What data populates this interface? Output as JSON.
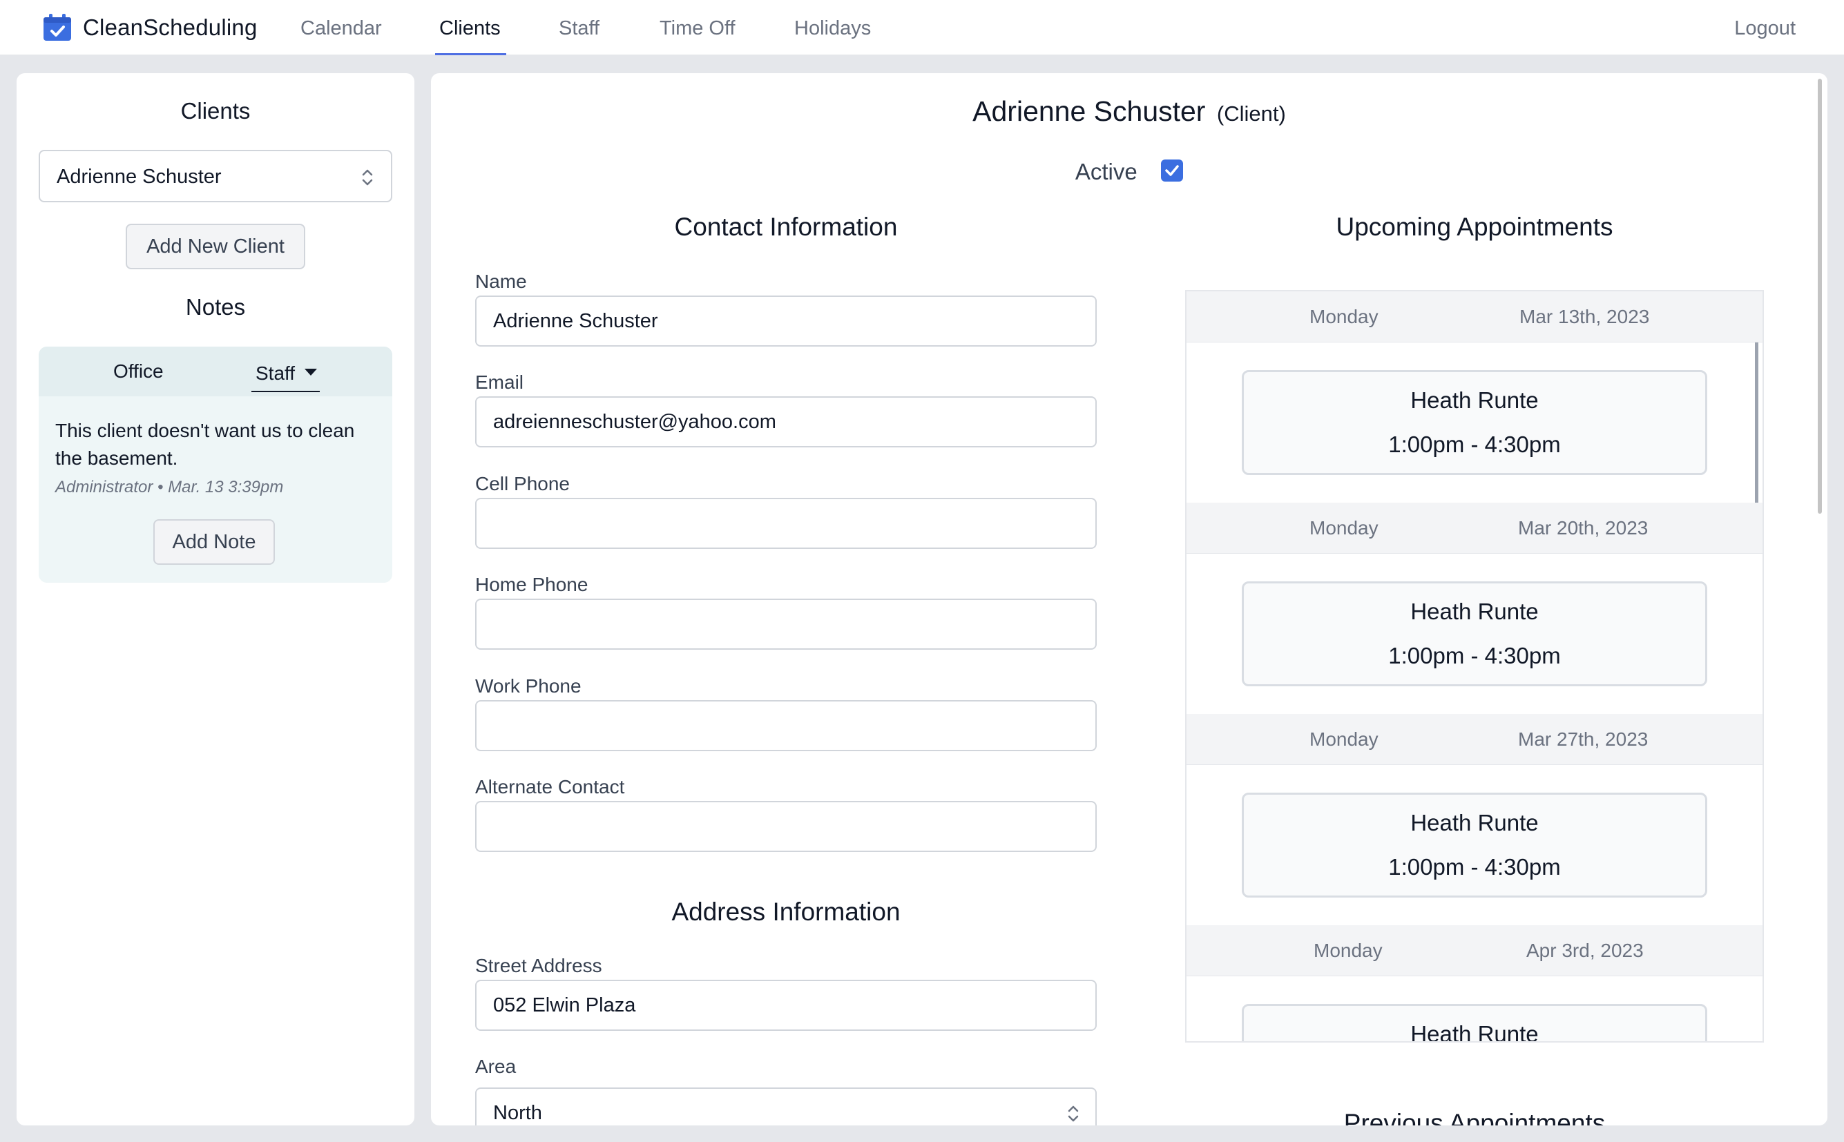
{
  "app": {
    "name": "CleanScheduling"
  },
  "nav": {
    "items": [
      {
        "label": "Calendar"
      },
      {
        "label": "Clients"
      },
      {
        "label": "Staff"
      },
      {
        "label": "Time Off"
      },
      {
        "label": "Holidays"
      }
    ],
    "active": "Clients",
    "logout_label": "Logout"
  },
  "sidebar": {
    "title": "Clients",
    "selected_client": "Adrienne Schuster",
    "add_client_label": "Add New Client",
    "notes_title": "Notes",
    "notes_tabs": [
      {
        "label": "Office"
      },
      {
        "label": "Staff"
      }
    ],
    "notes_active_tab": "Staff",
    "notes": [
      {
        "text": "This client doesn't want us to clean the basement.",
        "author": "Administrator",
        "timestamp": "Mar. 13 3:39pm"
      }
    ],
    "note_meta_separator": "•",
    "add_note_label": "Add Note"
  },
  "client": {
    "name": "Adrienne Schuster",
    "role_tag": "(Client)",
    "active_label": "Active",
    "active": true
  },
  "contact": {
    "title": "Contact Information",
    "name_label": "Name",
    "name_value": "Adrienne Schuster",
    "email_label": "Email",
    "email_value": "adreienneschuster@yahoo.com",
    "cell_label": "Cell Phone",
    "cell_value": "",
    "home_label": "Home Phone",
    "home_value": "",
    "work_label": "Work Phone",
    "work_value": "",
    "alt_label": "Alternate Contact",
    "alt_value": ""
  },
  "address": {
    "title": "Address Information",
    "street_label": "Street Address",
    "street_value": "052 Elwin Plaza",
    "area_label": "Area",
    "area_value": "North"
  },
  "appointments": {
    "upcoming_title": "Upcoming Appointments",
    "previous_title": "Previous Appointments",
    "upcoming": [
      {
        "weekday": "Monday",
        "date": "Mar 13th, 2023",
        "staff": "Heath Runte",
        "time": "1:00pm - 4:30pm"
      },
      {
        "weekday": "Monday",
        "date": "Mar 20th, 2023",
        "staff": "Heath Runte",
        "time": "1:00pm - 4:30pm"
      },
      {
        "weekday": "Monday",
        "date": "Mar 27th, 2023",
        "staff": "Heath Runte",
        "time": "1:00pm - 4:30pm"
      },
      {
        "weekday": "Monday",
        "date": "Apr 3rd, 2023",
        "staff": "Heath Runte",
        "time": ""
      }
    ]
  },
  "colors": {
    "accent": "#4f6fe3",
    "checkbox": "#3b6ee0",
    "brand_icon": "#3b6ee0"
  }
}
